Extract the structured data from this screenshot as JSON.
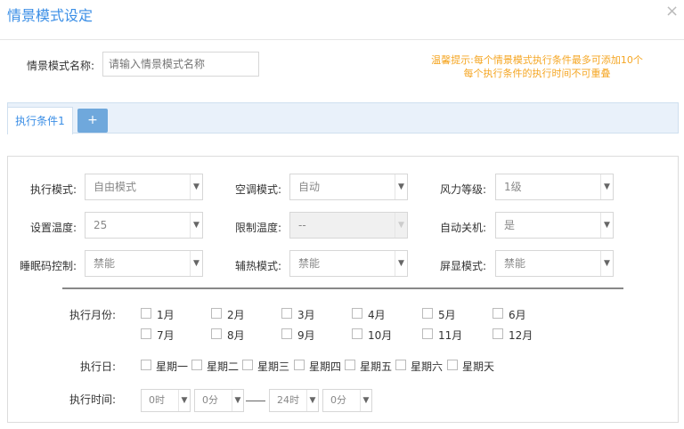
{
  "dialog": {
    "title": "情景模式设定",
    "close": "×"
  },
  "name": {
    "label": "情景模式名称:",
    "placeholder": "请输入情景模式名称"
  },
  "tip": {
    "line1": "温馨提示:每个情景模式执行条件最多可添加10个",
    "line2": "每个执行条件的执行时间不可重叠"
  },
  "tabs": {
    "tab1": "执行条件1",
    "add": "+"
  },
  "icons": {
    "close": "close-icon",
    "add": "plus-icon",
    "dropdown": "chevron-down-icon"
  },
  "form": {
    "exec_mode": {
      "label": "执行模式:",
      "value": "自由模式"
    },
    "ac_mode": {
      "label": "空调模式:",
      "value": "自动"
    },
    "wind_level": {
      "label": "风力等级:",
      "value": "1级"
    },
    "set_temp": {
      "label": "设置温度:",
      "value": "25"
    },
    "limit_temp": {
      "label": "限制温度:",
      "value": "--"
    },
    "auto_off": {
      "label": "自动关机:",
      "value": "是"
    },
    "sleep_ctrl": {
      "label": "睡眠码控制:",
      "value": "禁能"
    },
    "aux_heat": {
      "label": "辅热模式:",
      "value": "禁能"
    },
    "screen": {
      "label": "屏显模式:",
      "value": "禁能"
    }
  },
  "months": {
    "label": "执行月份:",
    "items": [
      "1月",
      "2月",
      "3月",
      "4月",
      "5月",
      "6月",
      "7月",
      "8月",
      "9月",
      "10月",
      "11月",
      "12月"
    ]
  },
  "days": {
    "label": "执行日:",
    "items": [
      "星期一",
      "星期二",
      "星期三",
      "星期四",
      "星期五",
      "星期六",
      "星期天"
    ]
  },
  "time": {
    "label": "执行时间:",
    "start_hour": "0时",
    "start_min": "0分",
    "end_hour": "24时",
    "end_min": "0分"
  }
}
